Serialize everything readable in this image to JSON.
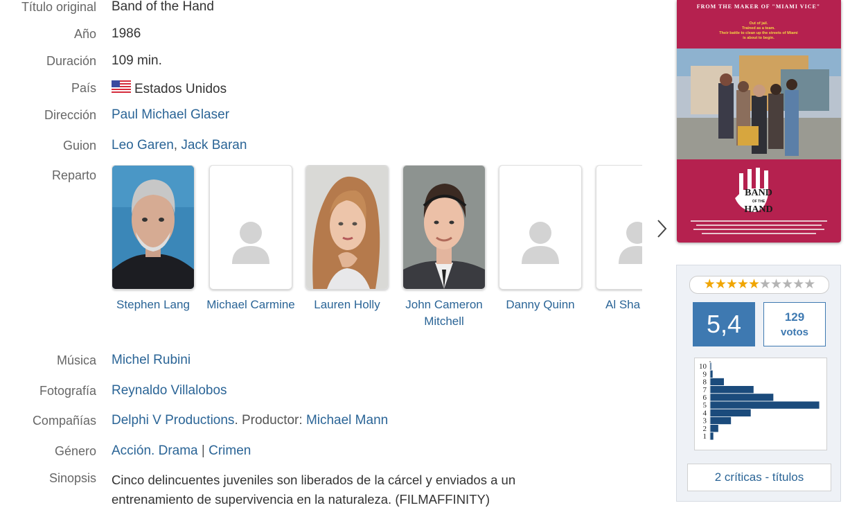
{
  "details": {
    "original_title": {
      "label": "Título original",
      "value": "Band of the Hand"
    },
    "year": {
      "label": "Año",
      "value": "1986"
    },
    "duration": {
      "label": "Duración",
      "value": "109 min."
    },
    "country": {
      "label": "País",
      "value": "Estados Unidos",
      "flag": "us-flag-icon"
    },
    "direction": {
      "label": "Dirección",
      "names": [
        "Paul Michael Glaser"
      ]
    },
    "screenplay": {
      "label": "Guion",
      "names": [
        "Leo Garen",
        "Jack Baran"
      ],
      "separator": ","
    },
    "cast": {
      "label": "Reparto",
      "members": [
        {
          "name": "Stephen Lang",
          "has_photo": true
        },
        {
          "name": "Michael Carmine",
          "has_photo": false
        },
        {
          "name": "Lauren Holly",
          "has_photo": true
        },
        {
          "name": "John Cameron Mitchell",
          "has_photo": true
        },
        {
          "name": "Danny Quinn",
          "has_photo": false
        },
        {
          "name": "Al Sha",
          "has_photo": false
        }
      ],
      "next_icon": "chevron-right-icon"
    },
    "music": {
      "label": "Música",
      "names": [
        "Michel Rubini"
      ]
    },
    "photography": {
      "label": "Fotografía",
      "names": [
        "Reynaldo Villalobos"
      ]
    },
    "companies": {
      "label": "Compañías",
      "company": "Delphi V Productions",
      "producer_text": ". Productor: ",
      "producer": "Michael Mann"
    },
    "genre": {
      "label": "Género",
      "g1": "Acción",
      "dot": ".",
      "g2": "Drama",
      "bar": "|",
      "g3": "Crimen"
    },
    "synopsis": {
      "label": "Sinopsis",
      "line1": "Cinco delincuentes juveniles son liberados de la cárcel y enviados a un",
      "line2": "entrenamiento de supervivencia en la naturaleza. (FILMAFFINITY)"
    }
  },
  "poster": {
    "tagline_top": "FROM THE MAKER OF \"MIAMI VICE\"",
    "tagline_lines": [
      "Out of jail.",
      "Trained as a team.",
      "Their battle to clean up the streets of Miami",
      "is about to begin."
    ],
    "logo_line1": "BAND",
    "logo_line2": "OF THE",
    "logo_line3": "HAND",
    "colors": {
      "background": "#b5214f",
      "tagline": "#f5d742"
    }
  },
  "rating": {
    "stars_filled": 5,
    "stars_total": 10,
    "average": "5,4",
    "votes_count": "129",
    "votes_label": "votos",
    "critics_link": "2 críticas - títulos",
    "histogram": {
      "labels": [
        "10",
        "9",
        "8",
        "7",
        "6",
        "5",
        "4",
        "3",
        "2",
        "1"
      ],
      "values": [
        2,
        4,
        20,
        62,
        90,
        155,
        58,
        30,
        12,
        5
      ]
    },
    "colors": {
      "accent": "#3e79b1",
      "histogram_bar": "#1b4b7c"
    }
  }
}
